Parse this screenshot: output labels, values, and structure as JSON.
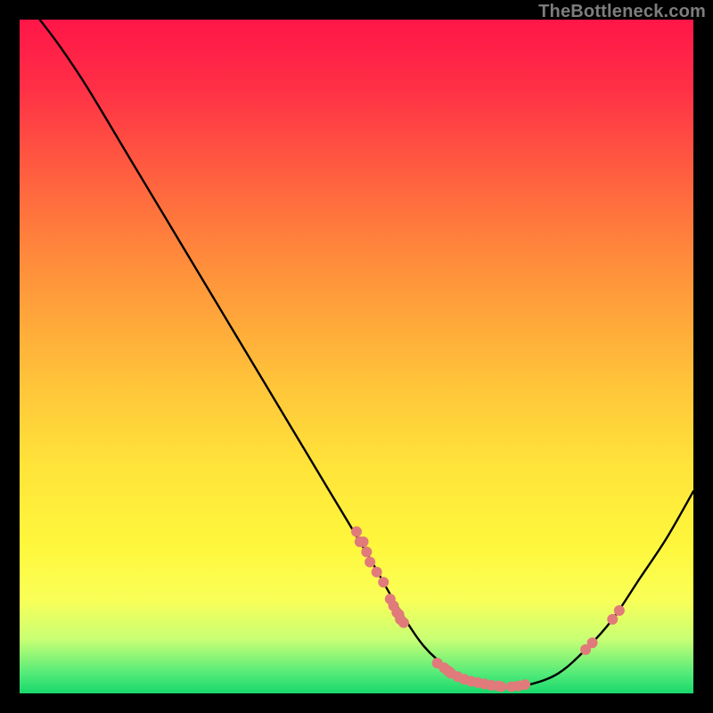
{
  "watermark": "TheBottleneck.com",
  "chart_data": {
    "type": "line",
    "title": "",
    "xlabel": "",
    "ylabel": "",
    "xlim": [
      0,
      100
    ],
    "ylim": [
      0,
      100
    ],
    "grid": false,
    "legend": false,
    "curve": [
      {
        "x": 3,
        "y": 100
      },
      {
        "x": 6,
        "y": 96
      },
      {
        "x": 10,
        "y": 90
      },
      {
        "x": 16,
        "y": 80
      },
      {
        "x": 22,
        "y": 70
      },
      {
        "x": 28,
        "y": 60
      },
      {
        "x": 34,
        "y": 50
      },
      {
        "x": 40,
        "y": 40
      },
      {
        "x": 46,
        "y": 30
      },
      {
        "x": 52,
        "y": 20
      },
      {
        "x": 56,
        "y": 13
      },
      {
        "x": 60,
        "y": 7
      },
      {
        "x": 64,
        "y": 3.5
      },
      {
        "x": 68,
        "y": 1.6
      },
      {
        "x": 72,
        "y": 1.0
      },
      {
        "x": 76,
        "y": 1.4
      },
      {
        "x": 80,
        "y": 3.0
      },
      {
        "x": 84,
        "y": 6.5
      },
      {
        "x": 88,
        "y": 11
      },
      {
        "x": 92,
        "y": 17
      },
      {
        "x": 96,
        "y": 23
      },
      {
        "x": 100,
        "y": 30
      }
    ],
    "dots": [
      {
        "x": 50,
        "y": 24
      },
      {
        "x": 50.5,
        "y": 22.5
      },
      {
        "x": 51.5,
        "y": 21
      },
      {
        "x": 51,
        "y": 22.5
      },
      {
        "x": 52,
        "y": 19.5
      },
      {
        "x": 53,
        "y": 18
      },
      {
        "x": 54,
        "y": 16.5
      },
      {
        "x": 55,
        "y": 14
      },
      {
        "x": 55.5,
        "y": 13
      },
      {
        "x": 56,
        "y": 12
      },
      {
        "x": 56.5,
        "y": 11
      },
      {
        "x": 56.3,
        "y": 11.7
      },
      {
        "x": 57,
        "y": 10.5
      },
      {
        "x": 62,
        "y": 4.5
      },
      {
        "x": 63,
        "y": 3.8
      },
      {
        "x": 63.5,
        "y": 3.4
      },
      {
        "x": 64,
        "y": 3.0
      },
      {
        "x": 63.8,
        "y": 3.2
      },
      {
        "x": 65,
        "y": 2.5
      },
      {
        "x": 66,
        "y": 2.1
      },
      {
        "x": 67,
        "y": 1.8
      },
      {
        "x": 68,
        "y": 1.6
      },
      {
        "x": 69,
        "y": 1.4
      },
      {
        "x": 70,
        "y": 1.2
      },
      {
        "x": 71,
        "y": 1.1
      },
      {
        "x": 71.5,
        "y": 1.0
      },
      {
        "x": 73,
        "y": 1.0
      },
      {
        "x": 74,
        "y": 1.1
      },
      {
        "x": 75,
        "y": 1.3
      },
      {
        "x": 84,
        "y": 6.5
      },
      {
        "x": 85,
        "y": 7.5
      },
      {
        "x": 88,
        "y": 11
      },
      {
        "x": 89,
        "y": 12.3
      }
    ],
    "dot_color": "#e17a7a",
    "curve_color": "#000000"
  }
}
